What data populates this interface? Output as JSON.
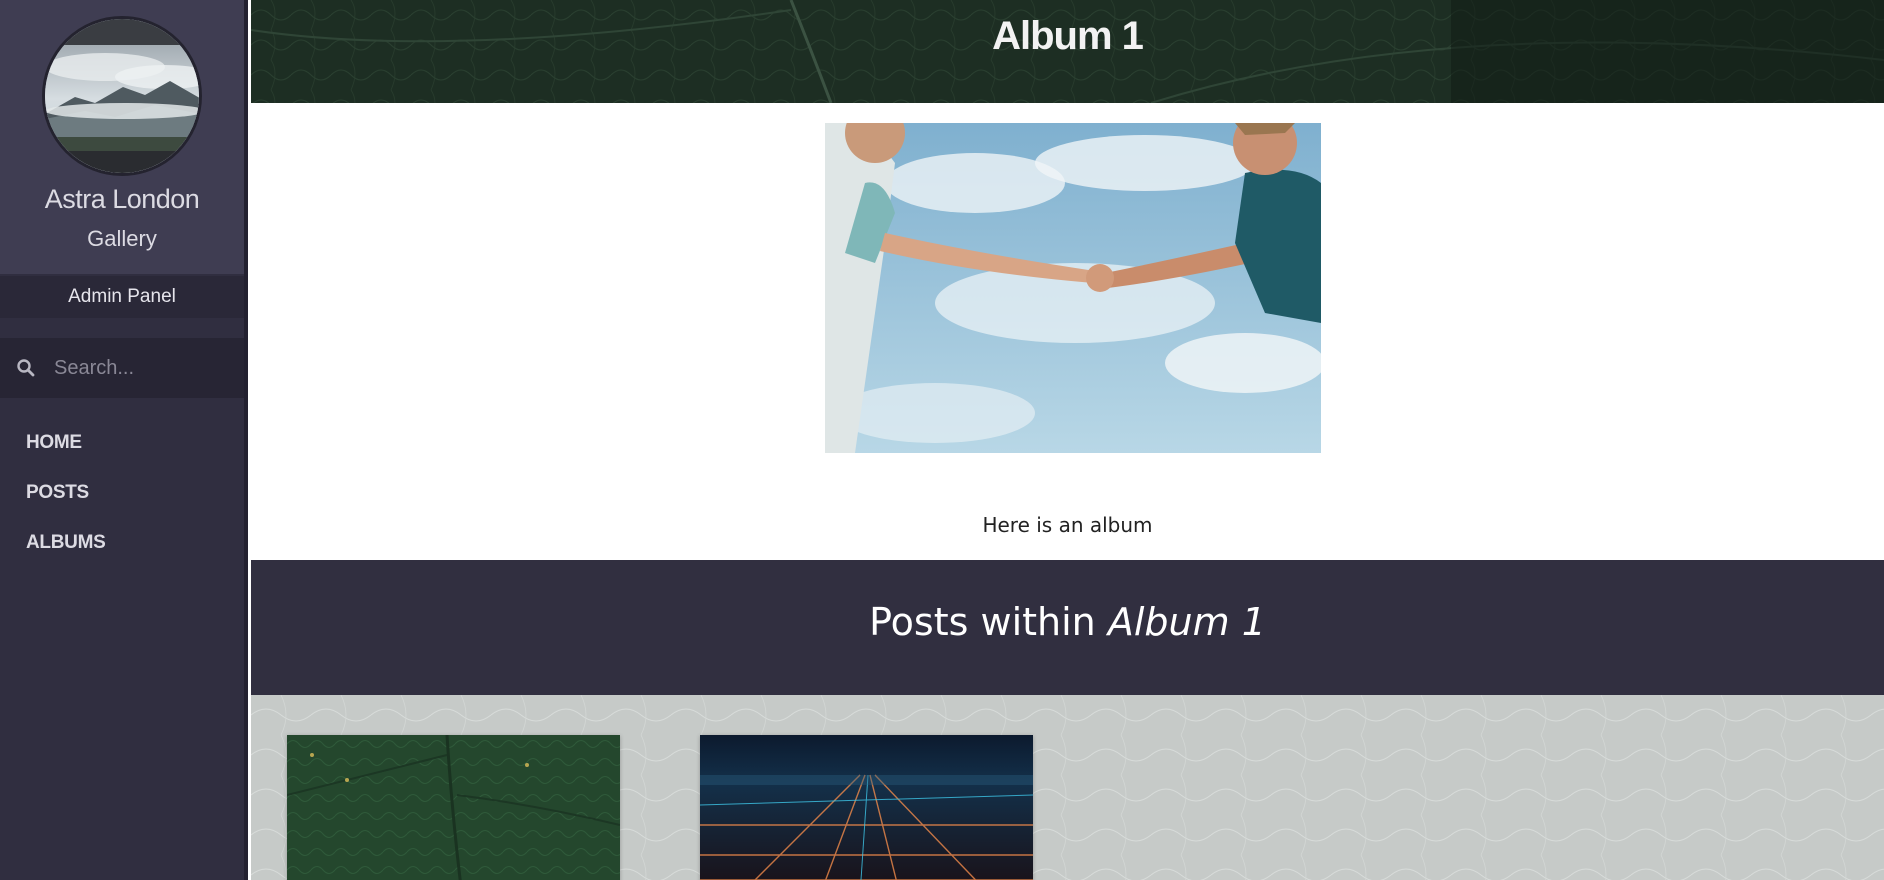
{
  "sidebar": {
    "profile": {
      "name": "Astra London",
      "subtitle": "Gallery"
    },
    "admin_panel_label": "Admin Panel",
    "search": {
      "placeholder": "Search..."
    },
    "nav_items": [
      {
        "label": "HOME"
      },
      {
        "label": "POSTS"
      },
      {
        "label": "ALBUMS"
      }
    ]
  },
  "album": {
    "title": "Album 1",
    "description": "Here is an album"
  },
  "posts_section": {
    "heading_prefix": "Posts within ",
    "heading_album": "Album 1"
  },
  "colors": {
    "sidebar_bg": "#302e40",
    "profile_bg": "#3f3d52",
    "posts_header_bg": "#312f40",
    "hero_bg": "#1b2a20"
  }
}
